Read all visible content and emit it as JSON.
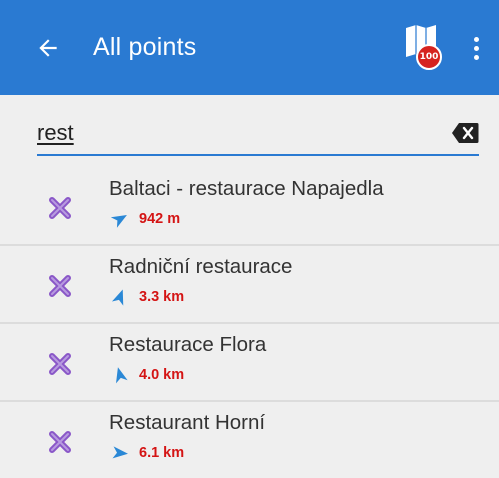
{
  "appbar": {
    "title": "All points",
    "back_icon": "arrow-left-icon",
    "map_icon": "map-flag-icon",
    "map_badge": "100",
    "more_icon": "more-vert-icon",
    "color": "#2a7ad2"
  },
  "search": {
    "value": "rest",
    "clear_icon": "backspace-clear-icon"
  },
  "results": [
    {
      "name": "Baltaci - restaurace Napajedla",
      "distance": "942 m",
      "bearing_deg": 60
    },
    {
      "name": "Radniční restaurace",
      "distance": "3.3 km",
      "bearing_deg": 20
    },
    {
      "name": "Restaurace Flora",
      "distance": "4.0 km",
      "bearing_deg": -15
    },
    {
      "name": "Restaurant Horní",
      "distance": "6.1 km",
      "bearing_deg": 95
    }
  ],
  "colors": {
    "accent": "#2a7ad2",
    "distance": "#d41414",
    "poi_icon": "#8a57c8",
    "direction_arrow": "#2a88d6"
  }
}
